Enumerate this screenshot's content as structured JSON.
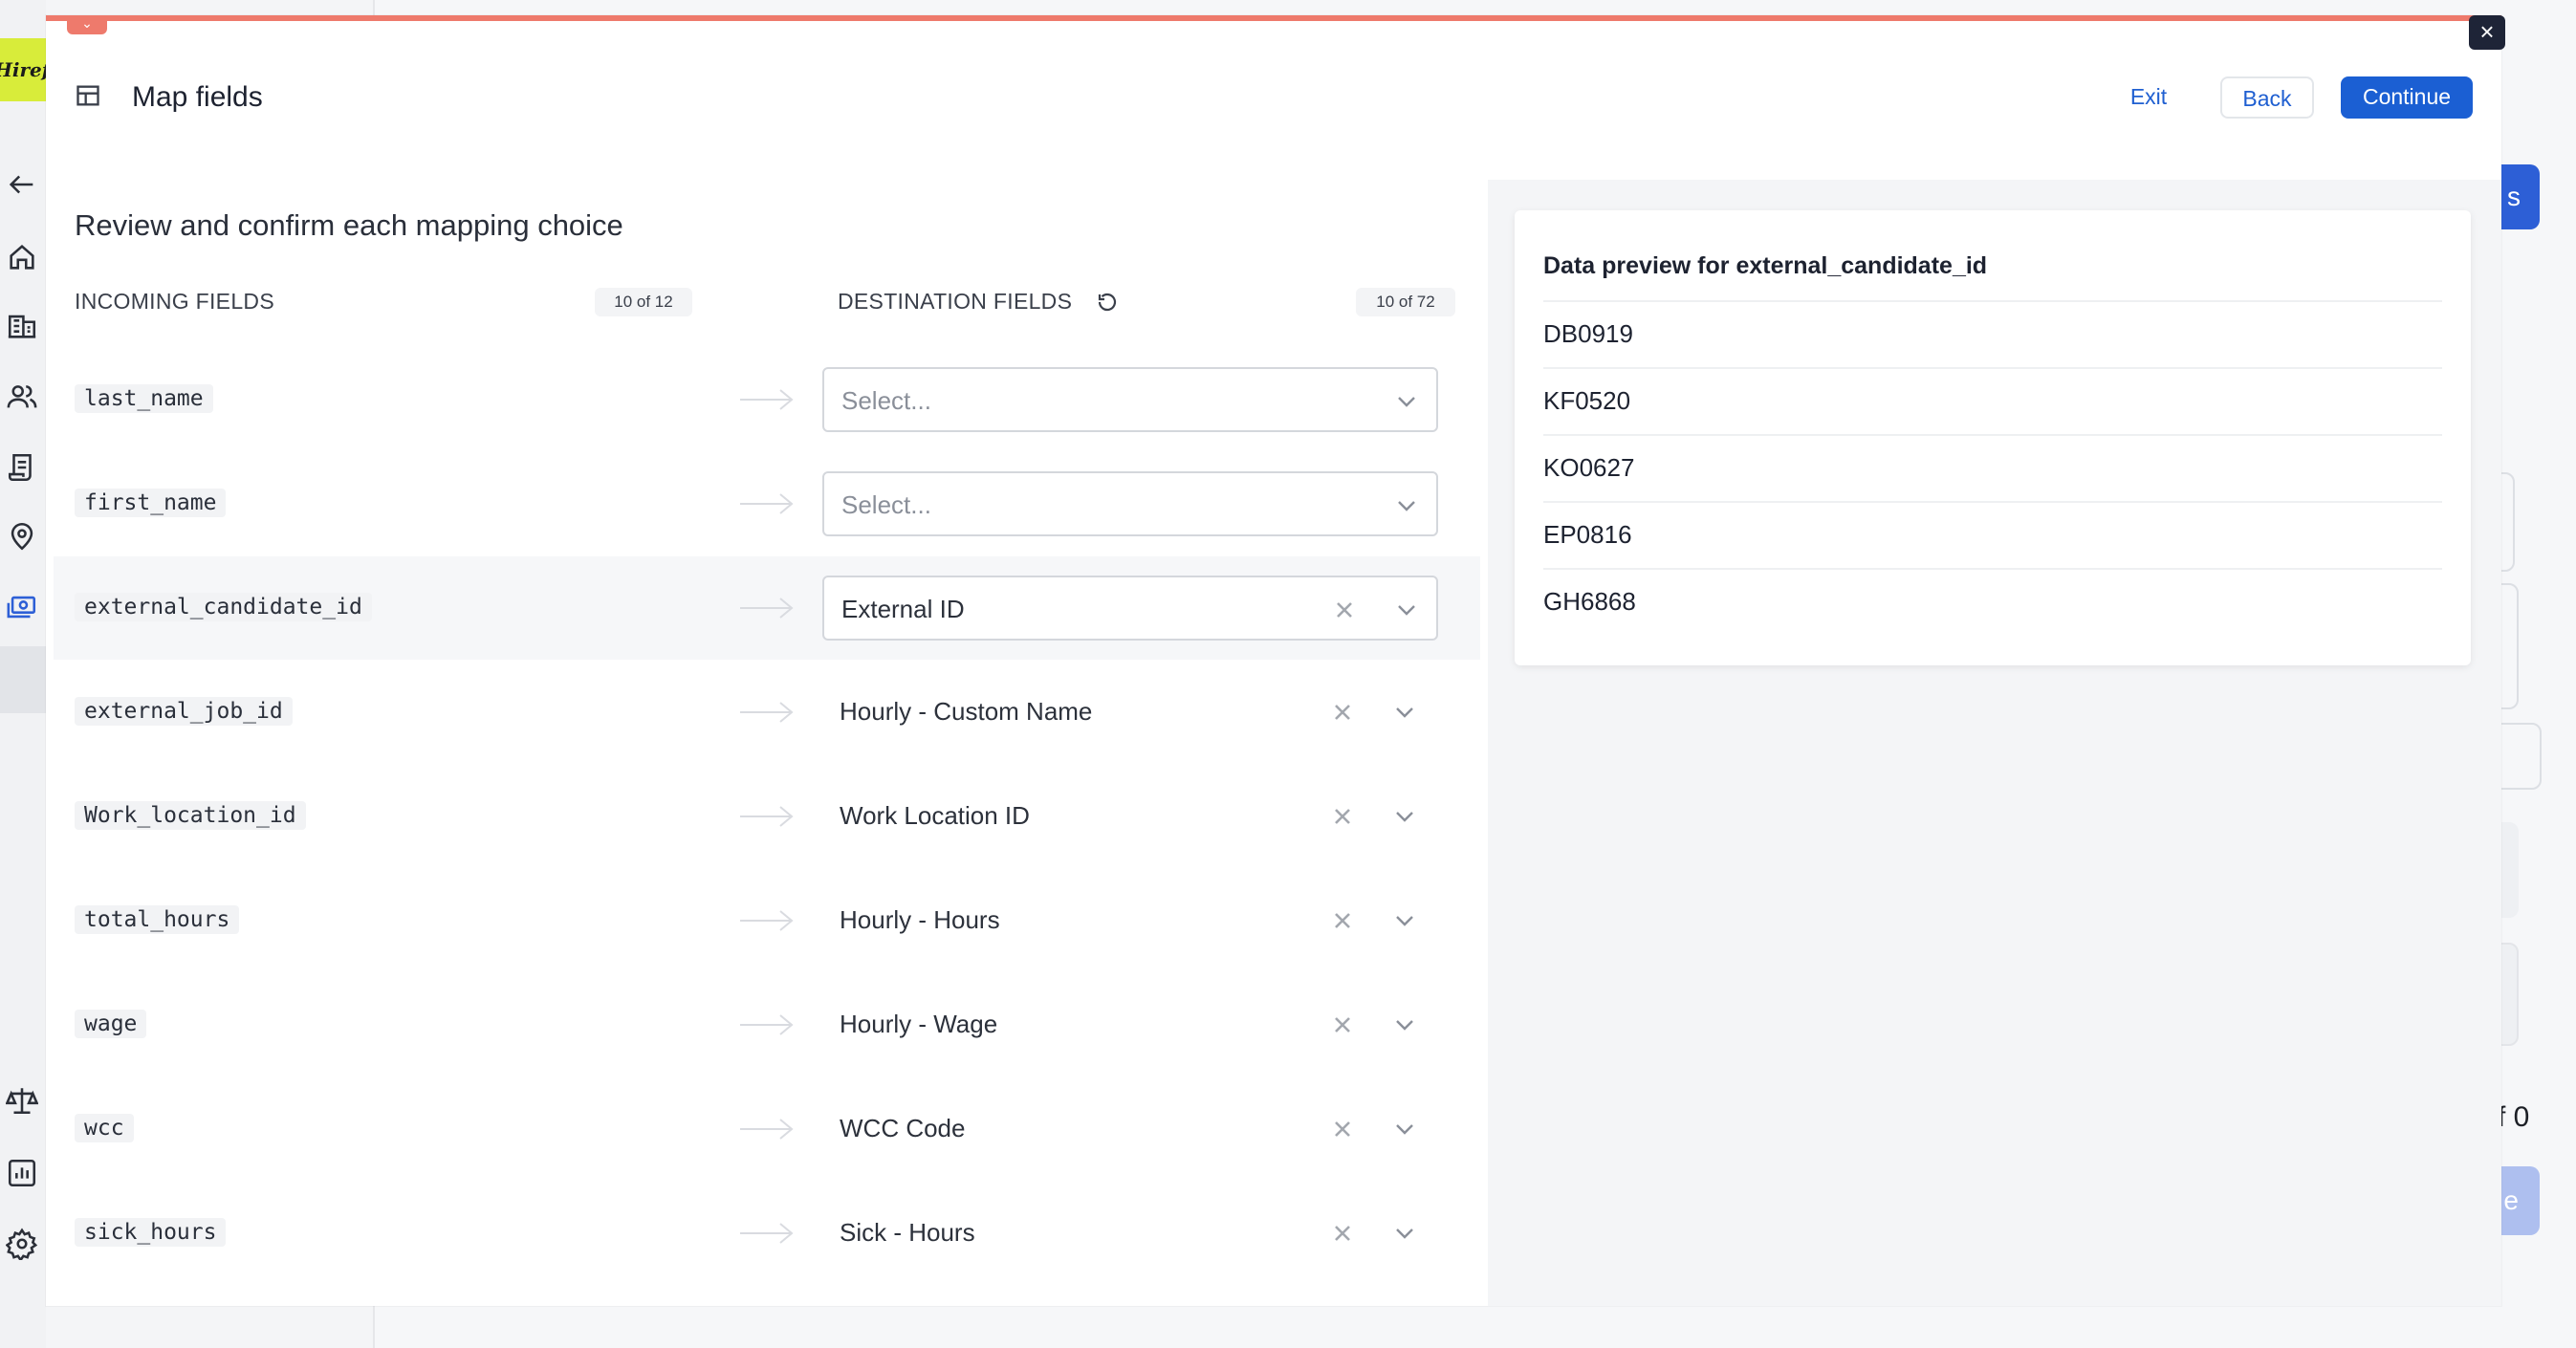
{
  "app": {
    "logo_text": "Hirefly",
    "bg_button_label": "s",
    "bg_pagination_text": "f 0",
    "bg_button2_label": "e"
  },
  "modal": {
    "title": "Map fields",
    "actions": {
      "exit": "Exit",
      "back": "Back",
      "continue": "Continue"
    },
    "heading": "Review and confirm each mapping choice",
    "incoming_header": "INCOMING FIELDS",
    "incoming_count": "10 of 12",
    "destination_header": "DESTINATION FIELDS",
    "destination_count": "10 of 72",
    "rows": [
      {
        "source": "last_name",
        "destination": "Select...",
        "state": "placeholder"
      },
      {
        "source": "first_name",
        "destination": "Select...",
        "state": "placeholder"
      },
      {
        "source": "external_candidate_id",
        "destination": "External ID",
        "state": "selected"
      },
      {
        "source": "external_job_id",
        "destination": "Hourly - Custom Name",
        "state": "mapped"
      },
      {
        "source": "Work_location_id",
        "destination": "Work Location ID",
        "state": "mapped"
      },
      {
        "source": "total_hours",
        "destination": "Hourly - Hours",
        "state": "mapped"
      },
      {
        "source": "wage",
        "destination": "Hourly - Wage",
        "state": "mapped"
      },
      {
        "source": "wcc",
        "destination": "WCC Code",
        "state": "mapped"
      },
      {
        "source": "sick_hours",
        "destination": "Sick - Hours",
        "state": "mapped"
      }
    ],
    "preview": {
      "title": "Data preview for external_candidate_id",
      "values": [
        "DB0919",
        "KF0520",
        "KO0627",
        "EP0816",
        "GH6868"
      ]
    }
  },
  "colors": {
    "accent": "#1b5fd3",
    "progress": "#ee7a6c",
    "logo_bg": "#d8ec3a"
  }
}
